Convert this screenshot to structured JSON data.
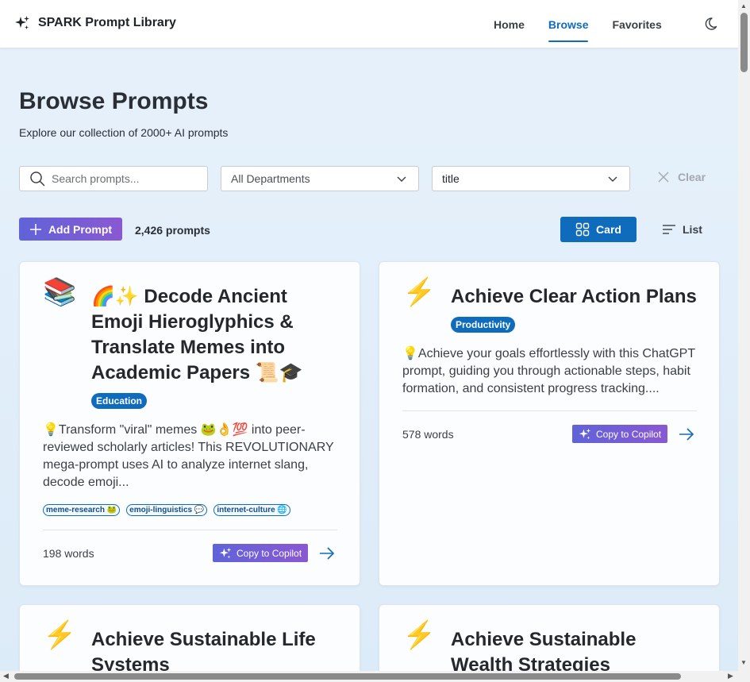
{
  "header": {
    "brand_title": "SPARK Prompt Library",
    "nav": [
      {
        "label": "Home",
        "active": false
      },
      {
        "label": "Browse",
        "active": true
      },
      {
        "label": "Favorites",
        "active": false
      }
    ]
  },
  "page": {
    "title": "Browse Prompts",
    "subtitle": "Explore our collection of 2000+ AI prompts"
  },
  "filters": {
    "search_placeholder": "Search prompts...",
    "department_selected": "All Departments",
    "sort_selected": "title",
    "clear_label": "Clear"
  },
  "toolbar": {
    "add_label": "Add Prompt",
    "count_label": "2,426 prompts",
    "view_card_label": "Card",
    "view_list_label": "List"
  },
  "cards": [
    {
      "emoji": "📚",
      "title": "🌈✨ Decode Ancient Emoji Hieroglyphics & Translate Memes into Academic Papers 📜🎓",
      "badge": "Education",
      "description": "💡Transform \"viral\" memes 🐸👌💯 into peer-reviewed scholarly articles! This REVOLUTIONARY mega-prompt uses AI to analyze internet slang, decode emoji...",
      "tags": [
        "meme-research 🐸",
        "emoji-linguistics 💬",
        "internet-culture 🌐"
      ],
      "words": "198 words",
      "copy_label": "Copy to Copilot"
    },
    {
      "emoji": "⚡",
      "title": "Achieve Clear Action Plans",
      "badge": "Productivity",
      "description": "💡Achieve your goals effortlessly with this ChatGPT prompt, guiding you through actionable steps, habit formation, and consistent progress tracking....",
      "tags": [],
      "words": "578 words",
      "copy_label": "Copy to Copilot"
    },
    {
      "emoji": "⚡",
      "title": "Achieve Sustainable Life Systems"
    },
    {
      "emoji": "⚡",
      "title": "Achieve Sustainable Wealth Strategies"
    }
  ],
  "colors": {
    "primary": "#0f6cbd",
    "gradient_start": "#6063d8",
    "gradient_end": "#8a58d3"
  }
}
